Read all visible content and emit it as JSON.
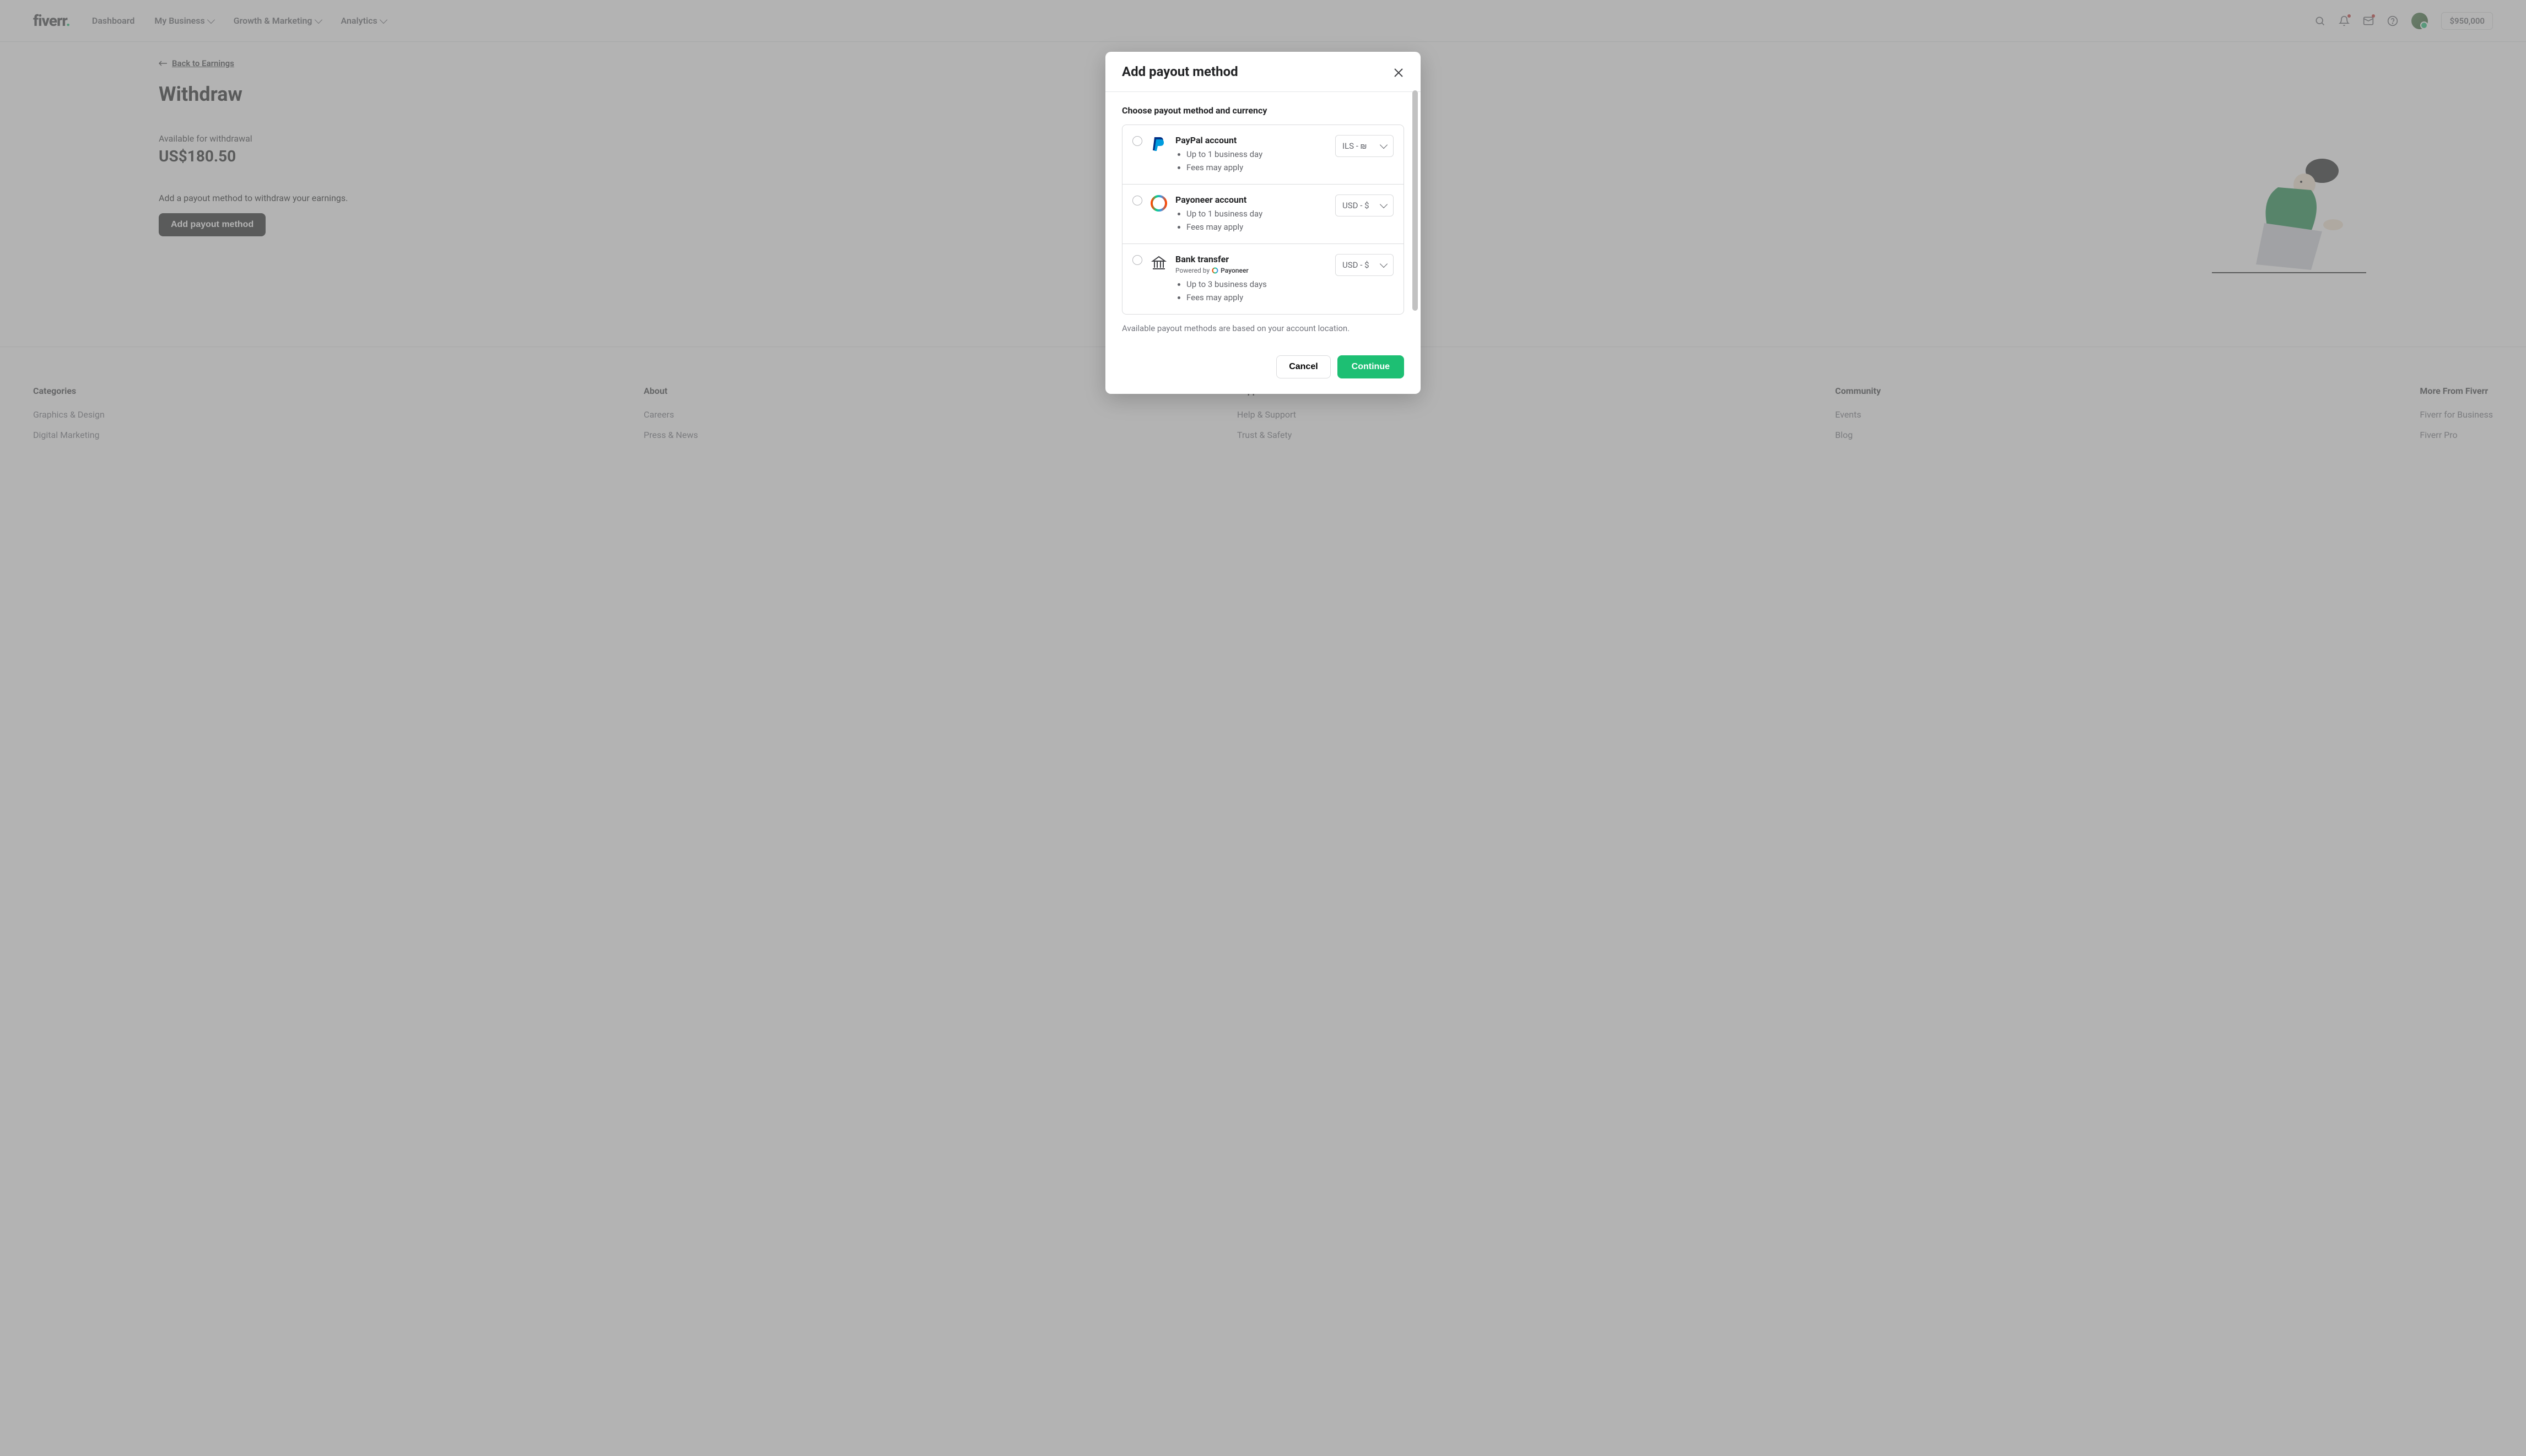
{
  "header": {
    "logo_text": "fiverr",
    "logo_dot": ".",
    "nav": [
      {
        "label": "Dashboard",
        "has_chevron": false
      },
      {
        "label": "My Business",
        "has_chevron": true
      },
      {
        "label": "Growth & Marketing",
        "has_chevron": true
      },
      {
        "label": "Analytics",
        "has_chevron": true
      }
    ],
    "balance": "$950,000"
  },
  "page": {
    "back_link": "Back to Earnings",
    "title": "Withdraw",
    "available_label": "Available for withdrawal",
    "amount": "US$180.50",
    "add_method_prompt": "Add a payout method to withdraw your earnings.",
    "add_button": "Add payout method"
  },
  "modal": {
    "title": "Add payout method",
    "subtitle": "Choose payout method and currency",
    "options": [
      {
        "name": "PayPal account",
        "details": [
          "Up to 1 business day",
          "Fees may apply"
        ],
        "currency": "ILS - ₪",
        "powered_by": null
      },
      {
        "name": "Payoneer account",
        "details": [
          "Up to 1 business day",
          "Fees may apply"
        ],
        "currency": "USD - $",
        "powered_by": null
      },
      {
        "name": "Bank transfer",
        "details": [
          "Up to 3 business days",
          "Fees may apply"
        ],
        "currency": "USD - $",
        "powered_by": "Powered by"
      }
    ],
    "note": "Available payout methods are based on your account location.",
    "cancel": "Cancel",
    "continue": "Continue"
  },
  "footer": {
    "columns": [
      {
        "title": "Categories",
        "links": [
          "Graphics & Design",
          "Digital Marketing"
        ]
      },
      {
        "title": "About",
        "links": [
          "Careers",
          "Press & News"
        ]
      },
      {
        "title": "Support",
        "links": [
          "Help & Support",
          "Trust & Safety"
        ]
      },
      {
        "title": "Community",
        "links": [
          "Events",
          "Blog"
        ]
      },
      {
        "title": "More From Fiverr",
        "links": [
          "Fiverr for Business",
          "Fiverr Pro"
        ]
      }
    ]
  }
}
